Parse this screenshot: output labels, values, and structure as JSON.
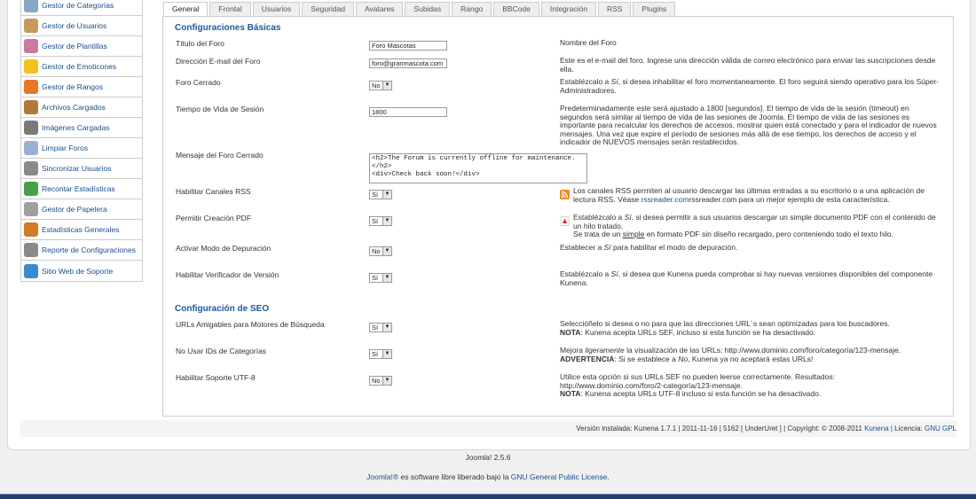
{
  "sidebar": {
    "items": [
      {
        "label": "Gestor de Categorías",
        "icon": "categories-icon",
        "color": "#8aa6c8"
      },
      {
        "label": "Gestor de Usuarios",
        "icon": "users-icon",
        "color": "#c89a5a"
      },
      {
        "label": "Gestor de Plantillas",
        "icon": "templates-icon",
        "color": "#c87aa0"
      },
      {
        "label": "Gestor de Emoticones",
        "icon": "smiley-icon",
        "color": "#f2c21b"
      },
      {
        "label": "Gestor de Rangos",
        "icon": "star-icon",
        "color": "#e8772a"
      },
      {
        "label": "Archivos Cargados",
        "icon": "files-icon",
        "color": "#b07a3a"
      },
      {
        "label": "Imágenes Cargadas",
        "icon": "images-icon",
        "color": "#7a7a7a"
      },
      {
        "label": "Limpiar Foros",
        "icon": "clean-icon",
        "color": "#9bb0d0"
      },
      {
        "label": "Sincronizar Usuarios",
        "icon": "sync-users-icon",
        "color": "#8a8a8a"
      },
      {
        "label": "Recontar Estadísticas",
        "icon": "recount-icon",
        "color": "#4aa04a"
      },
      {
        "label": "Gestor de Papelera",
        "icon": "trash-icon",
        "color": "#a0a0a0"
      },
      {
        "label": "Estadísticas Generales",
        "icon": "stats-icon",
        "color": "#d07a2a"
      },
      {
        "label": "Reporte de Configuraciones",
        "icon": "report-icon",
        "color": "#8a8a8a"
      },
      {
        "label": "Sitio Web de Soporte",
        "icon": "support-icon",
        "color": "#3a8ad0"
      }
    ]
  },
  "tabs": [
    "General",
    "Frontal",
    "Usuarios",
    "Seguridad",
    "Avatares",
    "Subidas",
    "Rango",
    "BBCode",
    "Integración",
    "RSS",
    "Plugins"
  ],
  "sections": {
    "basic": "Configuraciones Básicas",
    "seo": "Configuración de SEO"
  },
  "fields": {
    "forum_title": {
      "label": "Título del Foro",
      "value": "Foro Mascotas",
      "desc": "Nombre del Foro"
    },
    "forum_email": {
      "label": "Dirección E-mail del Foro",
      "value": "foro@granmascota.com",
      "desc": "Este es el e-mail del foro. Ingrese una dirección válida de correo electrónico para enviar las suscripciones desde ella."
    },
    "forum_closed": {
      "label": "Foro Cerrado",
      "value": "No",
      "desc_pre": "Establézcalo a ",
      "desc_em": "Sí",
      "desc_post": ", si desea inhabilitar el foro momentaneamente. El foro seguirá siendo operativo para los Súper-Administradores."
    },
    "session_time": {
      "label": "Tiempo de Vida de Sesión",
      "value": "1800",
      "desc": "Predeterminadamente este será ajustado a 1800 [segundos]. El tiempo de vida de la sesión (timeout) en segundos será similar al tiempo de vida de las sesiones de Joomla. El tiempo de vida de las sesiones es importante para recalcular los derechos de accesos, mostrar quien está conectado y para el indicador de nuevos mensajes. Una vez que expire el período de sesiones más allá de ese tiempo, los derechos de acceso y el indicador de NUEVOS mensajes serán restablecidos."
    },
    "closed_msg": {
      "label": "Mensaje del Foro Cerrado",
      "value": "<h2>The Forum is currently offline for maintenance.\n</h2>\n<div>Check back soon!</div>"
    },
    "rss": {
      "label": "Habilitar Canales RSS",
      "value": "Sí",
      "desc_pre": "Los canales RSS permiten al usuario descargar las últimas entradas a su escritorio o a una aplicación de lectura RSS. Véase ",
      "desc_link": "rssreader.com",
      "desc_post": "rssreader.com para un mejor ejemplo de esta característica."
    },
    "pdf": {
      "label": "Permitir Creación PDF",
      "value": "Sí",
      "desc_pre": "Establézcalo a ",
      "desc_em": "Sí",
      "desc_post": ", si desea permitir a sus usuarios descargar un simple documento PDF con el contenido de un hilo tratado.",
      "desc2_pre": "Se trata de un ",
      "desc2_u": "simple",
      "desc2_post": " en formato PDF sin diseño recargado, pero conteniendo todo el texto hilo."
    },
    "debug": {
      "label": "Activar Modo de Depuración",
      "value": "No",
      "desc_pre": "Establecer a ",
      "desc_em": "Sí",
      "desc_post": " para habilitar el modo de depuración."
    },
    "version_check": {
      "label": "Habilitar Verificador de Versión",
      "value": "Sí",
      "desc_pre": "Establézcalo a ",
      "desc_em": "Sí",
      "desc_post": ", si desea que Kunena pueda comprobar si hay nuevas versiones disponibles del componente Kunena."
    },
    "sef": {
      "label": "URLs Amigables para Motores de Búsqueda",
      "value": "Sí",
      "desc": "Seleccióñelo si desea o no para que las direcciones URL´s sean optimizadas para los buscadores.",
      "note_b": "NOTA",
      "note": ": Kunena acepta URLs SEF, incluso si esta función se ha desactivado."
    },
    "no_cat_ids": {
      "label": "No Usar IDs de Categorías",
      "value": "Sí",
      "desc_pre": "Mejora ",
      "desc_em": "ligeramente",
      "desc_post": " la visualización de las URLs: http://www.dominio.com/foro/categoría/123-mensaje.",
      "note_b": "ADVERTENCIA",
      "note_pre": ": Si se establece a ",
      "note_em": "No",
      "note_post": ", Kunena ya no aceptará estas URLs!"
    },
    "utf8": {
      "label": "Habilitar Soporte UTF-8",
      "value": "No",
      "desc": "Utilice esta opción si sus URLs SEF no pueden leerse correctamente. Resultados: http://www.dominio.com/foro/2-categoría/123-mensaje.",
      "note_b": "NOTA",
      "note": ": Kunena acepta URLs UTF-8 incluso si esta función se ha desactivado."
    }
  },
  "footer": {
    "version_pre": "Versión instalada: Kunena 1.7.1 | 2011-11-16 | 5162 [ UnderUret ] | Copyright: © 2008-2011 ",
    "kunena_link": "Kunena",
    "license_pre": " | Licencia: ",
    "gpl_link": "GNU GPL"
  },
  "joomla": {
    "version": "Joomla! 2.5.6",
    "brand": "Joomla!®",
    "lic_mid": " es software libre liberado bajo la ",
    "lic_link": "GNU General Public License",
    "lic_end": "."
  }
}
